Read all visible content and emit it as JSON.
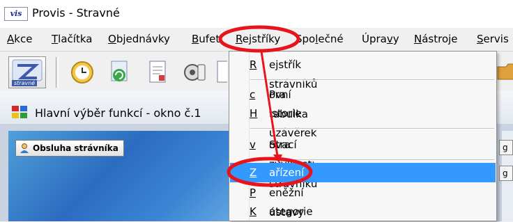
{
  "window": {
    "logo_text": "vis",
    "title": "Provis - Stravné"
  },
  "menubar": {
    "items": [
      {
        "pre": "",
        "u": "A",
        "post": "kce"
      },
      {
        "pre": "",
        "u": "T",
        "post": "lačítka"
      },
      {
        "pre": "",
        "u": "O",
        "post": "bjednávky"
      },
      {
        "pre": "",
        "u": "B",
        "post": "ufet"
      },
      {
        "pre": "",
        "u": "R",
        "post": "ejstříky"
      },
      {
        "pre": "Spo",
        "u": "l",
        "post": "ečné"
      },
      {
        "pre": "Úpra",
        "u": "v",
        "post": "y"
      },
      {
        "pre": "",
        "u": "N",
        "post": "ástroje"
      },
      {
        "pre": "",
        "u": "S",
        "post": "ervis"
      }
    ]
  },
  "toolbar": {
    "main_button_label": "stravné"
  },
  "inner_window": {
    "title": "Hlavní výběr funkcí - okno č.1",
    "button_label": "Obsluha strávníka",
    "edge_labels": [
      "g o",
      "g o"
    ]
  },
  "dropdown": {
    "items": [
      {
        "pre": "",
        "u": "R",
        "post": "ejstřík strávníků"
      },
      {
        "pre": "Pra",
        "u": "c",
        "post": "ovní tabulka"
      },
      {
        "pre": "",
        "u": "H",
        "post": "istorie uzávěrek"
      },
      {
        "pre": "Stra",
        "u": "v",
        "post": "ovací zyyklosti strávníků"
      },
      {
        "pre": "",
        "u": "Z",
        "post": "ařízení"
      },
      {
        "pre": "",
        "u": "P",
        "post": "eněžní ústavy"
      },
      {
        "pre": "",
        "u": "K",
        "post": "ategorie"
      }
    ],
    "selected_index": 4
  },
  "colors": {
    "highlight": "#3399ff",
    "annotation": "#e8141c"
  }
}
